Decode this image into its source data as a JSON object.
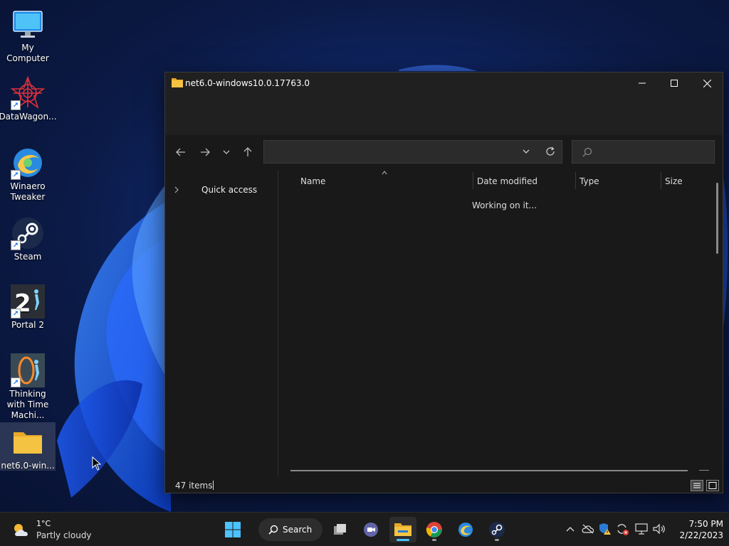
{
  "desktop": {
    "icons": [
      {
        "label": "My Computer"
      },
      {
        "label": "DataWagon..."
      },
      {
        "label": "Winaero Tweaker"
      },
      {
        "label": "Steam"
      },
      {
        "label": "Portal 2"
      },
      {
        "label": "Thinking with Time Machi..."
      },
      {
        "label": "net6.0-win..."
      }
    ]
  },
  "explorer": {
    "title": "net6.0-windows10.0.17763.0",
    "address_value": "",
    "search_placeholder": "",
    "nav": {
      "quick_access": "Quick access"
    },
    "columns": {
      "name": "Name",
      "date_modified": "Date modified",
      "type": "Type",
      "size": "Size"
    },
    "loading_text": "Working on it...",
    "status": {
      "item_count": "47 items"
    }
  },
  "taskbar": {
    "weather": {
      "temp": "1°C",
      "condition": "Partly cloudy"
    },
    "search_label": "Search",
    "clock": {
      "time": "7:50 PM",
      "date": "2/22/2023"
    }
  },
  "colors": {
    "accent": "#4cc2ff",
    "folder_yellow": "#f5c342",
    "window_bg": "#191919",
    "titlebar_bg": "#202020",
    "taskbar_bg": "#1c1c1c"
  }
}
